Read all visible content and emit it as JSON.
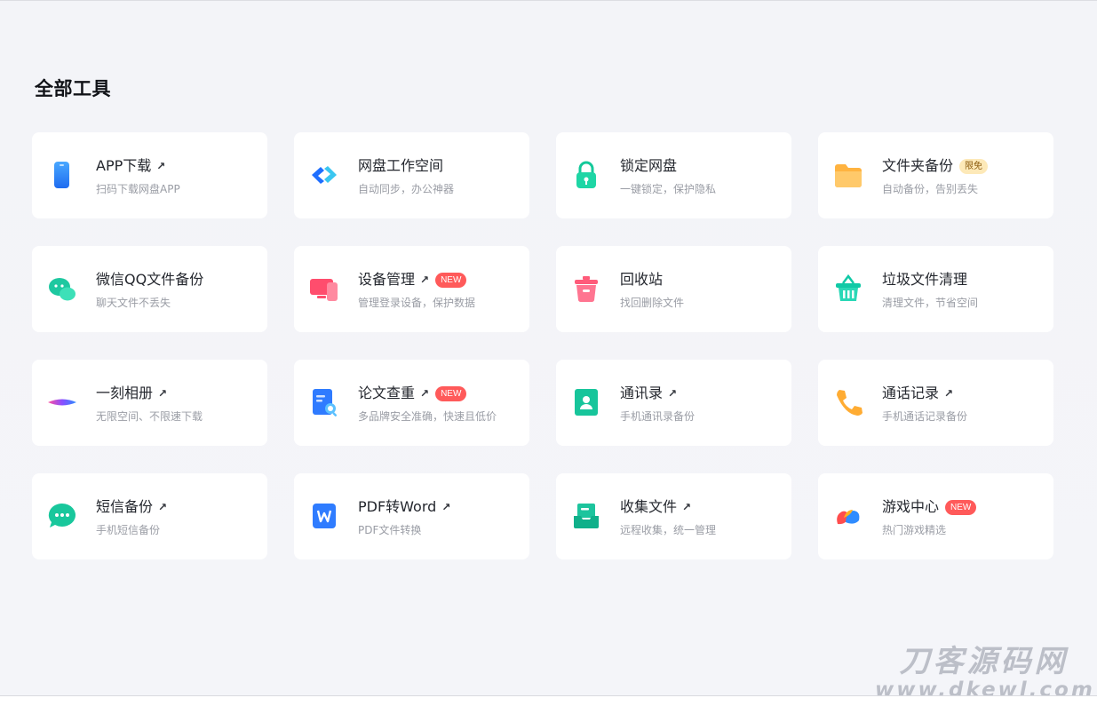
{
  "page": {
    "title": "全部工具"
  },
  "tools": [
    {
      "title": "APP下载",
      "subtitle": "扫码下载网盘APP",
      "external": true,
      "icon": "phone-icon"
    },
    {
      "title": "网盘工作空间",
      "subtitle": "自动同步，办公神器",
      "external": false,
      "icon": "workspace-icon"
    },
    {
      "title": "锁定网盘",
      "subtitle": "一键锁定，保护隐私",
      "external": false,
      "icon": "lock-icon"
    },
    {
      "title": "文件夹备份",
      "subtitle": "自动备份，告别丢失",
      "external": false,
      "icon": "folder-icon",
      "badge": "限免"
    },
    {
      "title": "微信QQ文件备份",
      "subtitle": "聊天文件不丢失",
      "external": false,
      "icon": "chat-bubbles-icon"
    },
    {
      "title": "设备管理",
      "subtitle": "管理登录设备，保护数据",
      "external": true,
      "icon": "devices-icon",
      "badge": "NEW"
    },
    {
      "title": "回收站",
      "subtitle": "找回删除文件",
      "external": false,
      "icon": "trash-icon"
    },
    {
      "title": "垃圾文件清理",
      "subtitle": "清理文件，节省空间",
      "external": false,
      "icon": "basket-icon"
    },
    {
      "title": "一刻相册",
      "subtitle": "无限空间、不限速下载",
      "external": true,
      "icon": "album-icon"
    },
    {
      "title": "论文查重",
      "subtitle": "多品牌安全准确，快速且低价",
      "external": true,
      "icon": "document-search-icon",
      "badge": "NEW"
    },
    {
      "title": "通讯录",
      "subtitle": "手机通讯录备份",
      "external": true,
      "icon": "contacts-icon"
    },
    {
      "title": "通话记录",
      "subtitle": "手机通话记录备份",
      "external": true,
      "icon": "phone-call-icon"
    },
    {
      "title": "短信备份",
      "subtitle": "手机短信备份",
      "external": true,
      "icon": "sms-icon"
    },
    {
      "title": "PDF转Word",
      "subtitle": "PDF文件转换",
      "external": true,
      "icon": "word-icon"
    },
    {
      "title": "收集文件",
      "subtitle": "远程收集，统一管理",
      "external": true,
      "icon": "inbox-icon"
    },
    {
      "title": "游戏中心",
      "subtitle": "热门游戏精选",
      "external": false,
      "icon": "game-icon",
      "badge": "NEW"
    }
  ],
  "arrow_glyph": "↗",
  "watermark": {
    "line1": "刀客源码网",
    "line2": "www.dkewl.com"
  },
  "colors": {
    "accent_new": "#ff5a5a",
    "badge_free_bg": "#fde9b8",
    "card_bg": "#ffffff",
    "page_bg": "#f4f5f9"
  }
}
